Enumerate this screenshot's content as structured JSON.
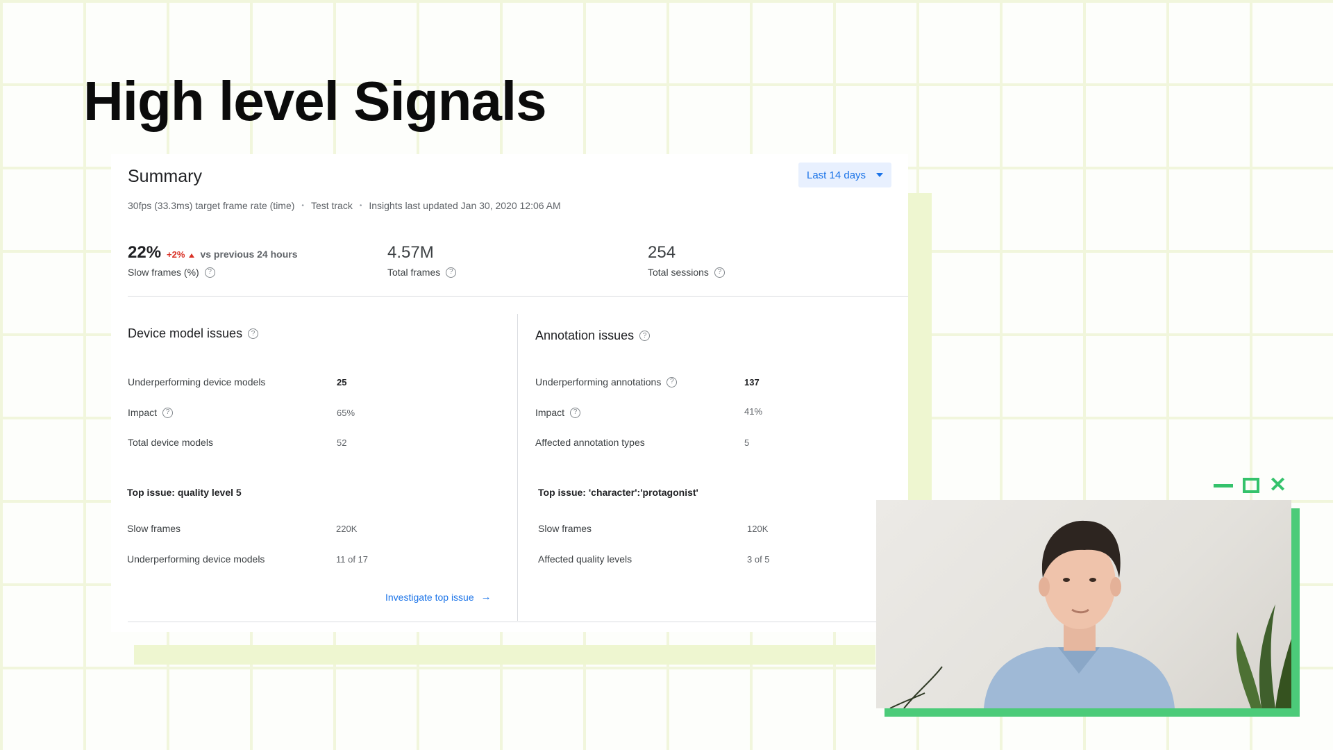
{
  "slide": {
    "title": "High level Signals"
  },
  "summary": {
    "title": "Summary",
    "range_label": "Last 14 days",
    "meta": {
      "target": "30fps (33.3ms) target frame rate (time)",
      "track": "Test track",
      "updated": "Insights last updated Jan 30, 2020 12:06 AM"
    },
    "stats": {
      "slow_frames": {
        "value": "22%",
        "delta": "+2%",
        "comparison": "vs previous 24 hours",
        "label": "Slow frames (%)"
      },
      "total_frames": {
        "value": "4.57M",
        "label": "Total frames"
      },
      "total_sessions": {
        "value": "254",
        "label": "Total sessions"
      }
    }
  },
  "device": {
    "title": "Device model issues",
    "rows": [
      {
        "label": "Underperforming device models",
        "value": "25"
      },
      {
        "label": "Impact",
        "value": "65%"
      },
      {
        "label": "Total device models",
        "value": "52"
      }
    ],
    "top_issue": "Top issue: quality level 5",
    "issue_rows": [
      {
        "label": "Slow frames",
        "value": "220K"
      },
      {
        "label": "Underperforming device models",
        "value": "11 of 17"
      }
    ],
    "link": "Investigate top issue"
  },
  "annotation": {
    "title": "Annotation issues",
    "rows": [
      {
        "label": "Underperforming annotations",
        "value": "137"
      },
      {
        "label": "Impact",
        "value": "41%"
      },
      {
        "label": "Affected annotation types",
        "value": "5"
      }
    ],
    "top_issue": "Top issue: 'character':'protagonist'",
    "issue_rows": [
      {
        "label": "Slow frames",
        "value": "120K"
      },
      {
        "label": "Affected quality levels",
        "value": "3 of 5"
      }
    ]
  },
  "icons": {
    "help": "question-circle-icon",
    "dropdown": "caret-down-icon",
    "link_arrow": "arrow-right-icon",
    "delta": "triangle-up-icon",
    "window": [
      "minimize-icon",
      "maximize-icon",
      "close-icon"
    ]
  },
  "colors": {
    "accent_blue": "#1a73e8",
    "delta_red": "#d93025",
    "window_green": "#34c26b",
    "grid_green": "#f1f6dc"
  }
}
